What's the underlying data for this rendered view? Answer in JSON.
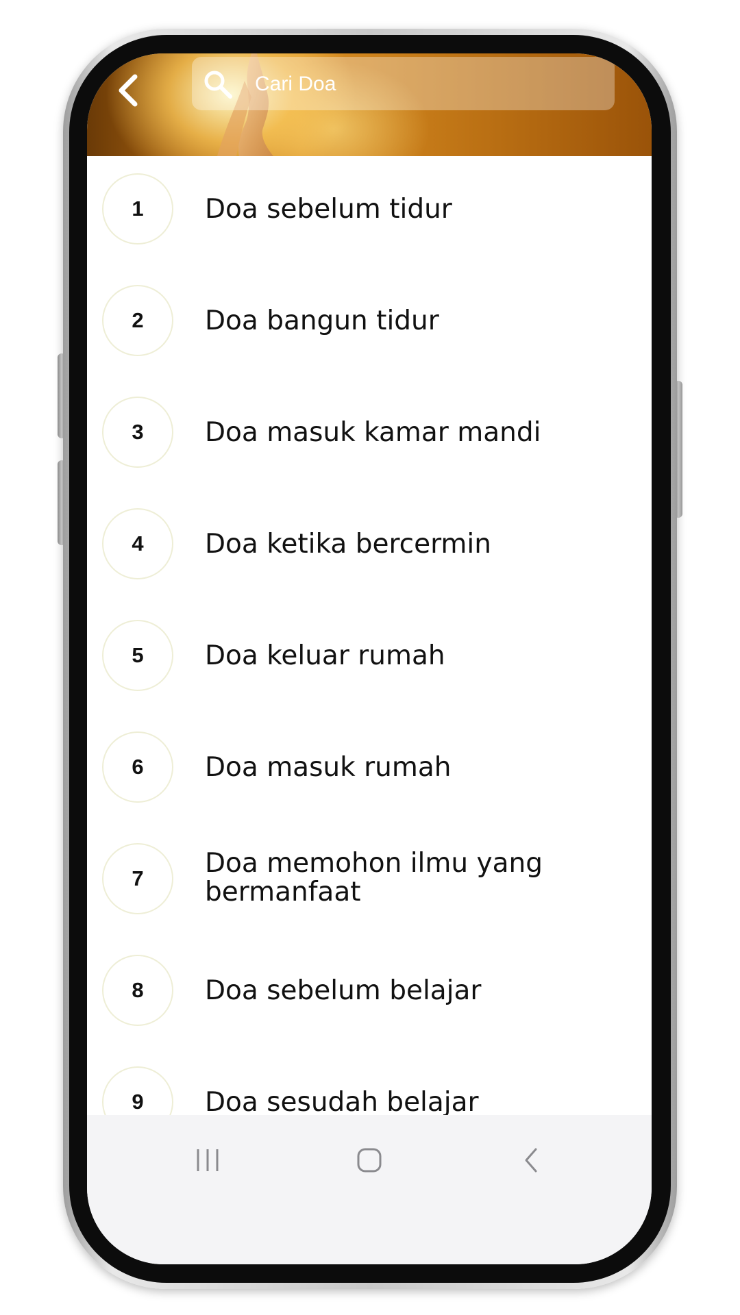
{
  "header": {
    "search_placeholder": "Cari Doa"
  },
  "icons": {
    "back": "chevron-left-icon",
    "search": "search-icon",
    "recents": "recent-apps-icon",
    "home": "home-icon",
    "nav_back": "back-icon"
  },
  "colors": {
    "header_gold": "#c57a18",
    "circle_border": "#eeeed6",
    "text": "#111111",
    "navbar_bg": "#f4f4f6"
  },
  "list": {
    "items": [
      {
        "number": "1",
        "title": "Doa sebelum tidur"
      },
      {
        "number": "2",
        "title": "Doa bangun tidur"
      },
      {
        "number": "3",
        "title": "Doa masuk kamar mandi"
      },
      {
        "number": "4",
        "title": "Doa ketika bercermin"
      },
      {
        "number": "5",
        "title": "Doa keluar rumah"
      },
      {
        "number": "6",
        "title": "Doa masuk rumah"
      },
      {
        "number": "7",
        "title": "Doa memohon ilmu yang bermanfaat"
      },
      {
        "number": "8",
        "title": "Doa sebelum belajar"
      },
      {
        "number": "9",
        "title": "Doa sesudah belajar"
      }
    ]
  }
}
